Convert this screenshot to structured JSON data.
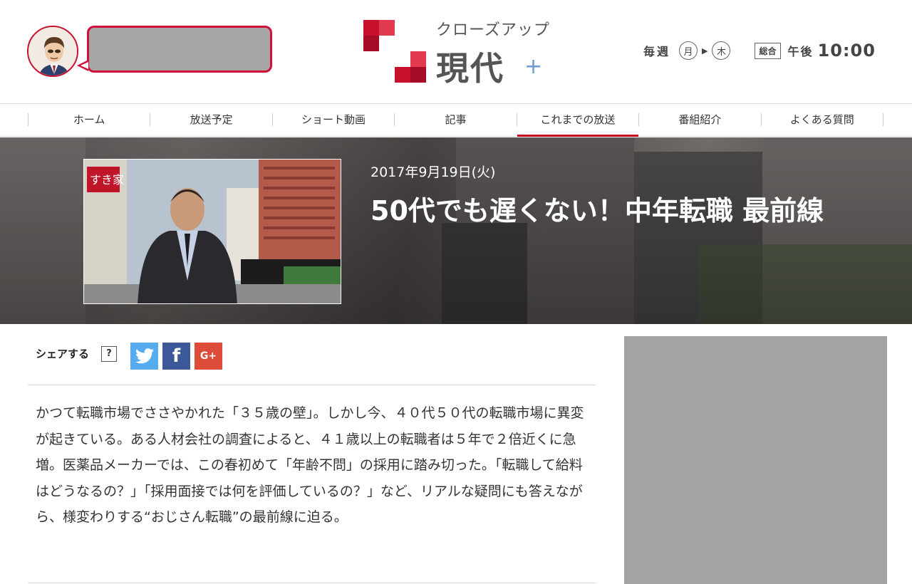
{
  "header": {
    "logo": {
      "kana": "クローズアップ",
      "kanji": "現代",
      "plus": "+"
    },
    "schedule": {
      "weekly": "毎週",
      "day_start": "月",
      "day_end": "木",
      "channel": "総合",
      "time_label": "午後",
      "time": "10:00"
    }
  },
  "nav": {
    "items": [
      {
        "label": "ホーム"
      },
      {
        "label": "放送予定"
      },
      {
        "label": "ショート動画"
      },
      {
        "label": "記事"
      },
      {
        "label": "これまでの放送"
      },
      {
        "label": "番組紹介"
      },
      {
        "label": "よくある質問"
      }
    ],
    "active_index": 4,
    "active_color": "#c00018"
  },
  "hero": {
    "date": "2017年9月19日(火)",
    "title": "50代でも遅くない！中年転職 最前線",
    "thumb_sign": "すき家"
  },
  "share": {
    "label": "シェアする",
    "help": "?",
    "twitter_icon": "twitter-icon",
    "facebook_icon": "facebook-icon",
    "facebook_glyph": "f",
    "googleplus_icon": "googleplus-icon",
    "googleplus_glyph": "G+"
  },
  "description": "かつて転職市場でささやかれた「３５歳の壁」。しかし今、４０代５０代の転職市場に異変が起きている。ある人材会社の調査によると、４１歳以上の転職者は５年で２倍近くに急増。医薬品メーカーでは、この春初めて「年齢不問」の採用に踏み切った。「転職して給料はどうなるの？」「採用面接では何を評価しているの？」など、リアルな疑問にも答えながら、様変わりする“おじさん転職”の最前線に迫る。",
  "colors": {
    "brand_red": "#c8102e",
    "twitter": "#55acee",
    "facebook": "#3b5998",
    "googleplus": "#dd4b39"
  }
}
